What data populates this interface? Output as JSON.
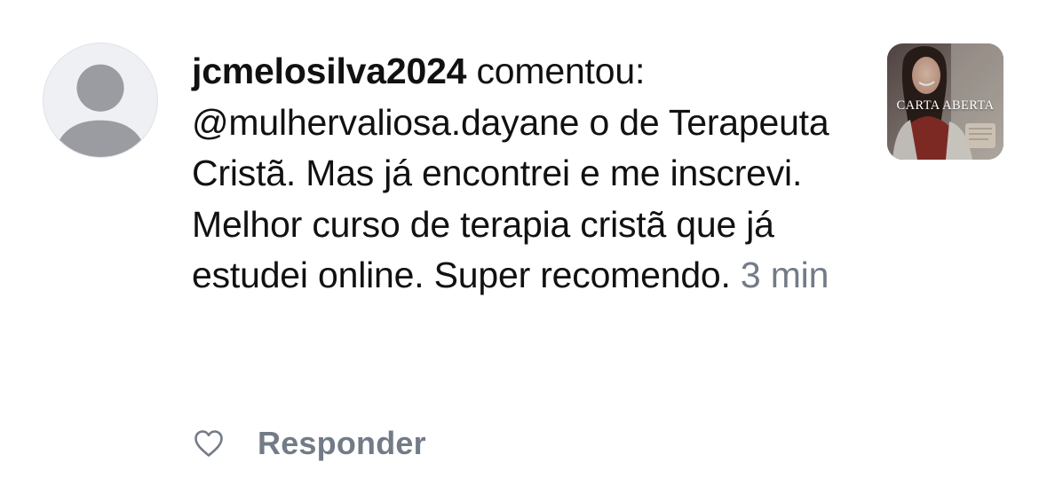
{
  "notification": {
    "username": "jcmelosilva2024",
    "verb": " comentou:",
    "mention": "@mulhervaliosa.dayane",
    "body": " o de Terapeuta Cristã. Mas já encontrei e me inscrevi. Melhor curso de terapia cristã que já estudei online. Super recomendo.",
    "timestamp": "3 min",
    "avatar_icon": "default-user-avatar-icon",
    "thumbnail": {
      "caption": "CARTA ABERTA"
    },
    "actions": {
      "like_icon": "heart-outline-icon",
      "reply_label": "Responder"
    },
    "colors": {
      "text": "#111111",
      "muted": "#737b87",
      "avatar_bg": "#eff0f3",
      "avatar_silhouette": "#9a9ca1"
    }
  }
}
